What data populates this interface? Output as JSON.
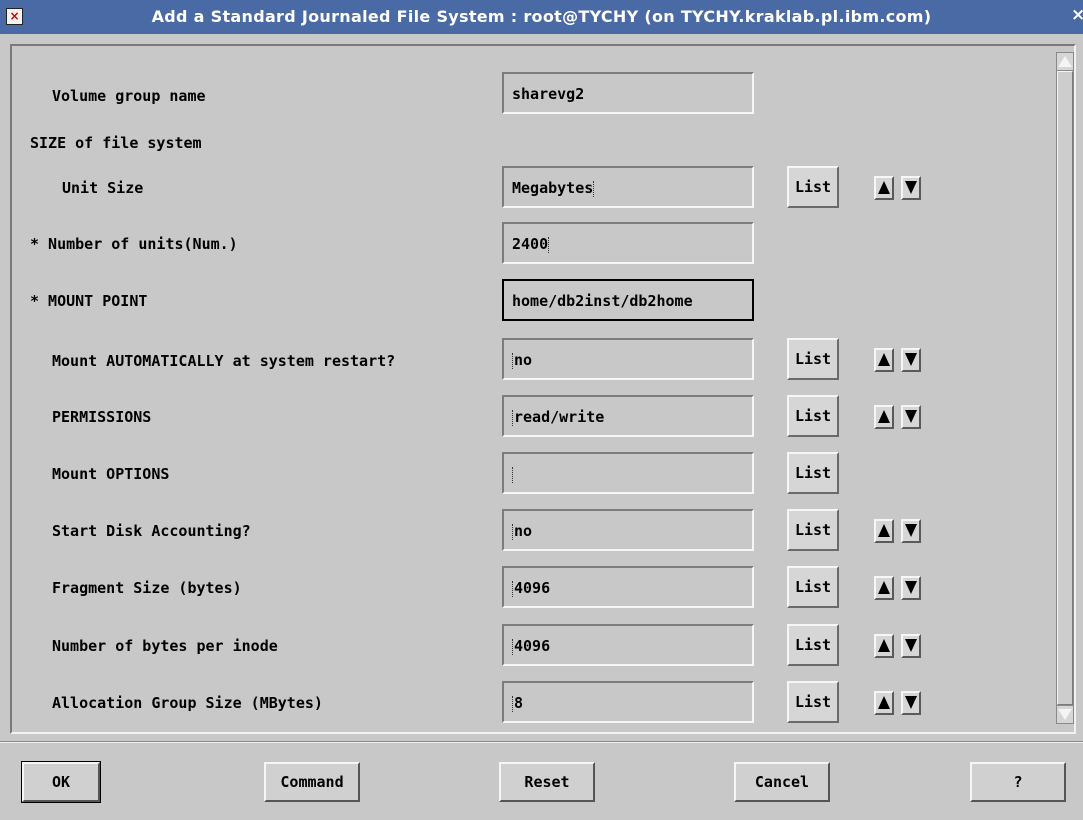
{
  "window": {
    "title": "Add a Standard Journaled File System : root@TYCHY (on TYCHY.kraklab.pl.ibm.com)",
    "close_glyph": "×",
    "menu_glyph": "×"
  },
  "form": {
    "volume_group": {
      "label": "Volume group name",
      "value": "sharevg2"
    },
    "size_section_label": "SIZE of file system",
    "unit_size": {
      "label": "Unit Size",
      "value": "Megabytes",
      "list": "List"
    },
    "num_units": {
      "label": "*  Number of units(Num.)",
      "value": "2400"
    },
    "mount_point": {
      "label": "* MOUNT POINT",
      "value": "home/db2inst/db2home"
    },
    "mount_auto": {
      "label": "Mount AUTOMATICALLY at system restart?",
      "value": "no",
      "list": "List"
    },
    "permissions": {
      "label": "PERMISSIONS",
      "value": "read/write",
      "list": "List"
    },
    "mount_options": {
      "label": "Mount OPTIONS",
      "value": "",
      "list": "List"
    },
    "disk_accounting": {
      "label": "Start Disk Accounting?",
      "value": "no",
      "list": "List"
    },
    "fragment_size": {
      "label": "Fragment Size (bytes)",
      "value": "4096",
      "list": "List"
    },
    "bytes_per_inode": {
      "label": "Number of bytes per inode",
      "value": "4096",
      "list": "List"
    },
    "alloc_group": {
      "label": "Allocation Group Size (MBytes)",
      "value": "8",
      "list": "List"
    }
  },
  "buttons": {
    "ok": "OK",
    "command": "Command",
    "reset": "Reset",
    "cancel": "Cancel",
    "help": "?"
  }
}
